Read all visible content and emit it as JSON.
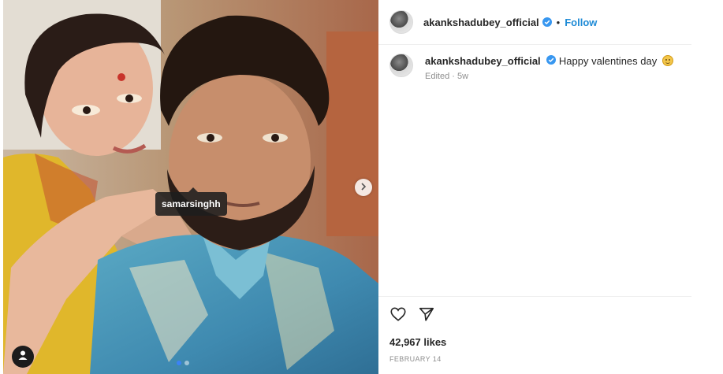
{
  "header": {
    "username": "akankshadubey_official",
    "separator": "•",
    "follow_label": "Follow"
  },
  "media": {
    "tag_label": "samarsinghh",
    "carousel_dots": 2,
    "active_dot": 0
  },
  "caption": {
    "username": "akankshadubey_official",
    "text": "Happy valentines day",
    "emoji": "smiling-face-emoji",
    "meta": "Edited · 5w"
  },
  "engagement": {
    "likes": "42,967 likes",
    "date": "FEBRUARY 14"
  },
  "icons": {
    "verified": "verified-badge-icon",
    "like": "heart-icon",
    "share": "paper-plane-icon",
    "next": "chevron-right-icon",
    "user_tag": "user-icon"
  },
  "colors": {
    "follow": "#1f8bd6",
    "verified": "#3897f0",
    "muted_text": "#8e8e8e"
  }
}
